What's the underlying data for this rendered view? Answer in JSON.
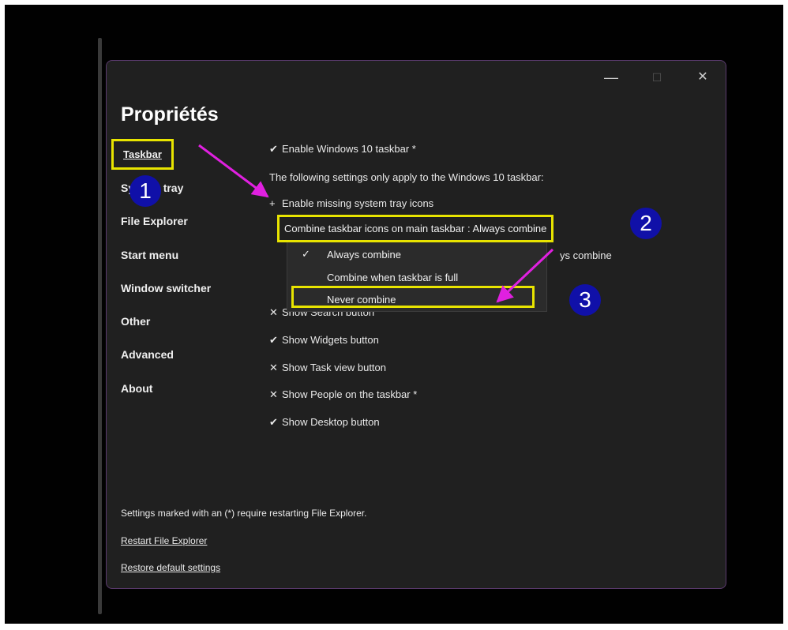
{
  "window": {
    "title": "Propriétés",
    "controls": {
      "minimize": "—",
      "maximize": "☐",
      "close": "✕"
    }
  },
  "nav": [
    {
      "id": "taskbar",
      "label": "Taskbar",
      "selected": true
    },
    {
      "id": "system-tray",
      "label": "System tray"
    },
    {
      "id": "file-explorer",
      "label": "File Explorer"
    },
    {
      "id": "start-menu",
      "label": "Start menu"
    },
    {
      "id": "window-switcher",
      "label": "Window switcher"
    },
    {
      "id": "other",
      "label": "Other"
    },
    {
      "id": "advanced",
      "label": "Advanced"
    },
    {
      "id": "about",
      "label": "About"
    }
  ],
  "settings": {
    "enable_win10_taskbar": {
      "glyph": "✔",
      "label": "Enable Windows 10 taskbar *"
    },
    "info_text": "The following settings only apply to the Windows 10 taskbar:",
    "enable_tray_icons": {
      "glyph": "+",
      "label": "Enable missing system tray icons"
    },
    "combine_main": "Combine taskbar icons on main taskbar : Always combine",
    "combine_secondary_partial": "ys combine",
    "search_button": {
      "glyph": "✕",
      "label": "Show Search button"
    },
    "widgets_button": {
      "glyph": "✔",
      "label": "Show Widgets button"
    },
    "task_view_button": {
      "glyph": "✕",
      "label": "Show Task view button"
    },
    "people_taskbar": {
      "glyph": "✕",
      "label": "Show People on the taskbar *"
    },
    "desktop_button": {
      "glyph": "✔",
      "label": "Show Desktop button"
    }
  },
  "dropdown": {
    "options": [
      {
        "label": "Always combine",
        "check": "✓",
        "selected": true
      },
      {
        "label": "Combine when taskbar is full",
        "check": "",
        "selected": false
      },
      {
        "label": "Never combine",
        "check": "",
        "selected": false
      }
    ]
  },
  "footer": {
    "note": "Settings marked with an (*) require restarting File Explorer.",
    "restart_link": "Restart File Explorer",
    "restore_link": "Restore default settings"
  },
  "badges": {
    "one": "1",
    "two": "2",
    "three": "3"
  },
  "colors": {
    "highlight": "#e8e400",
    "badge": "#1010a8",
    "arrow": "#e020e0",
    "window_bg": "#202020",
    "window_border": "#5b3a6e"
  }
}
